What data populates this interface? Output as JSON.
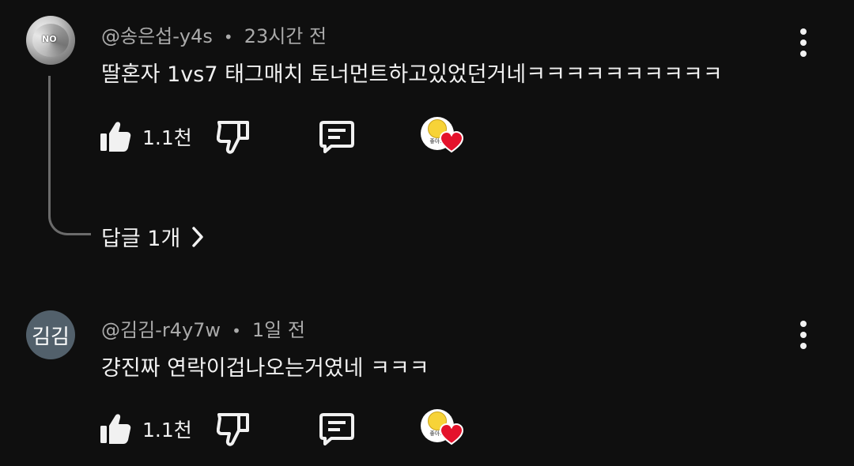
{
  "comments": [
    {
      "author": "@송은섭-y4s",
      "time": "23시간 전",
      "text": "딸혼자 1vs7 태그매치 토너먼트하고있었던거네ㅋㅋㅋㅋㅋㅋㅋㅋㅋㅋ",
      "likes": "1.1천",
      "avatar_tag": "NO",
      "heart_label": "좋아요",
      "replies_label": "답글 1개"
    },
    {
      "author": "@김김-r4y7w",
      "time": "1일 전",
      "text": "걍진짜 연락이겁나오는거였네 ㅋㅋㅋ",
      "likes": "1.1천",
      "avatar_letter": "김김",
      "heart_label": "좋아요"
    }
  ],
  "icons": {
    "like": "thumbs-up-icon",
    "dislike": "thumbs-down-icon",
    "reply": "comment-icon",
    "more": "more-vertical-icon",
    "creator_heart": "creator-heart-icon",
    "expand": "chevron-right-icon"
  },
  "colors": {
    "background": "#0f0f0f",
    "text": "#f1f1f1",
    "meta": "#aaaaaa",
    "heart": "#e4122b",
    "avatar_letter_bg": "#52606b"
  }
}
